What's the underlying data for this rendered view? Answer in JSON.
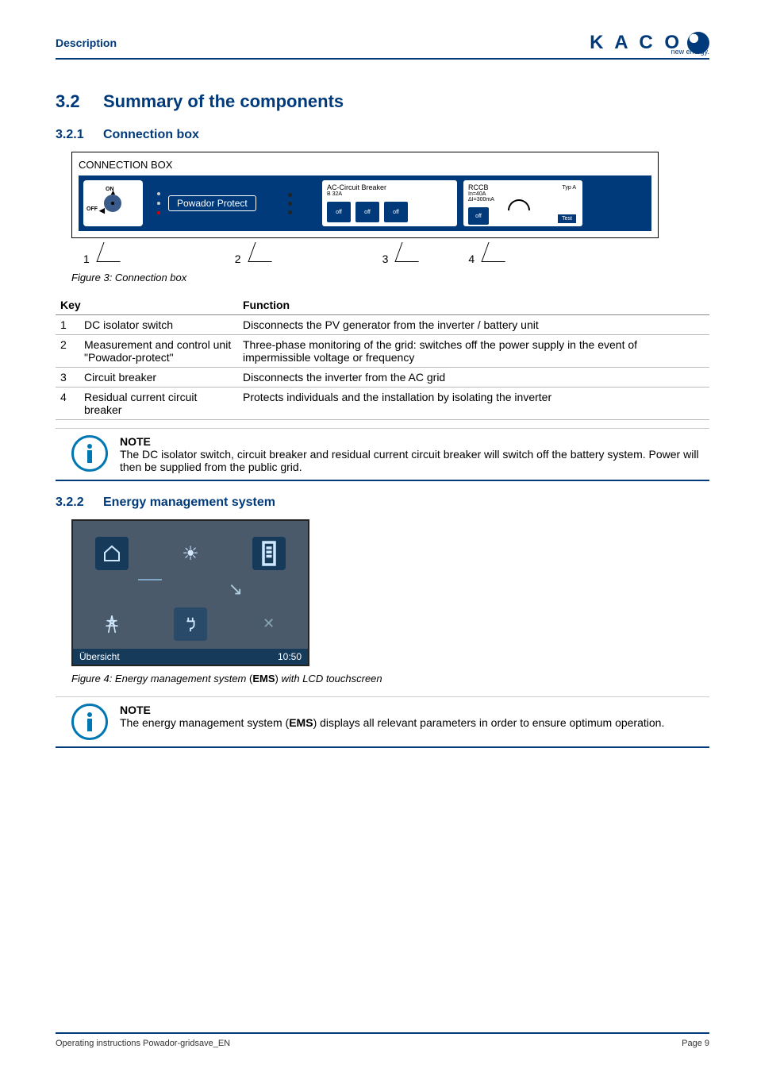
{
  "header": {
    "section": "Description",
    "logo": "K A C O",
    "tagline": "new energy."
  },
  "sec": {
    "num": "3.2",
    "title": "Summary of the components",
    "sub1": {
      "num": "3.2.1",
      "title": "Connection box"
    },
    "sub2": {
      "num": "3.2.2",
      "title": "Energy management system"
    }
  },
  "connbox": {
    "title": "CONNECTION BOX",
    "on": "ON",
    "off": "OFF",
    "protect": "Powador Protect",
    "cb_title": "AC-Circuit Breaker",
    "cb_sub": "B 32A",
    "cb_off": "off",
    "rccb_title": "RCCB",
    "rccb_l1": "In=40A",
    "rccb_l2": "ΔI=300mA",
    "rccb_typ": "Typ A",
    "rccb_off": "off",
    "rccb_test": "Test",
    "c1": "1",
    "c2": "2",
    "c3": "3",
    "c4": "4"
  },
  "fig3": "Figure 3:   Connection box",
  "table": {
    "h1": "Key",
    "h2": "Function",
    "rows": [
      {
        "k": "1",
        "n": "DC isolator switch",
        "f": "Disconnects the PV generator from the inverter / battery unit"
      },
      {
        "k": "2",
        "n": "Measurement and control unit\n\"Powador-protect\"",
        "f": "Three-phase monitoring of the grid: switches off the power supply in the event of impermissible voltage or frequency"
      },
      {
        "k": "3",
        "n": "Circuit breaker",
        "f": "Disconnects the inverter from the AC grid"
      },
      {
        "k": "4",
        "n": "Residual current circuit breaker",
        "f": "Protects individuals and the installation by isolating the inverter"
      }
    ]
  },
  "note1": {
    "title": "NOTE",
    "body": "The DC isolator switch, circuit breaker and residual current circuit breaker will switch off the battery system. Power will then be supplied from the public grid."
  },
  "ems": {
    "status": "Übersicht",
    "time": "10:50"
  },
  "fig4_a": "Figure 4:   Energy management system ",
  "fig4_b": "(",
  "fig4_c": "EMS",
  "fig4_d": ")",
  "fig4_e": " with LCD touchscreen",
  "note2": {
    "title": "NOTE",
    "body_a": "The energy management system (",
    "body_b": "EMS",
    "body_c": ") displays all relevant parameters in order to ensure optimum operation."
  },
  "footer": {
    "left": "Operating instructions Powador-gridsave_EN",
    "right": "Page 9"
  }
}
